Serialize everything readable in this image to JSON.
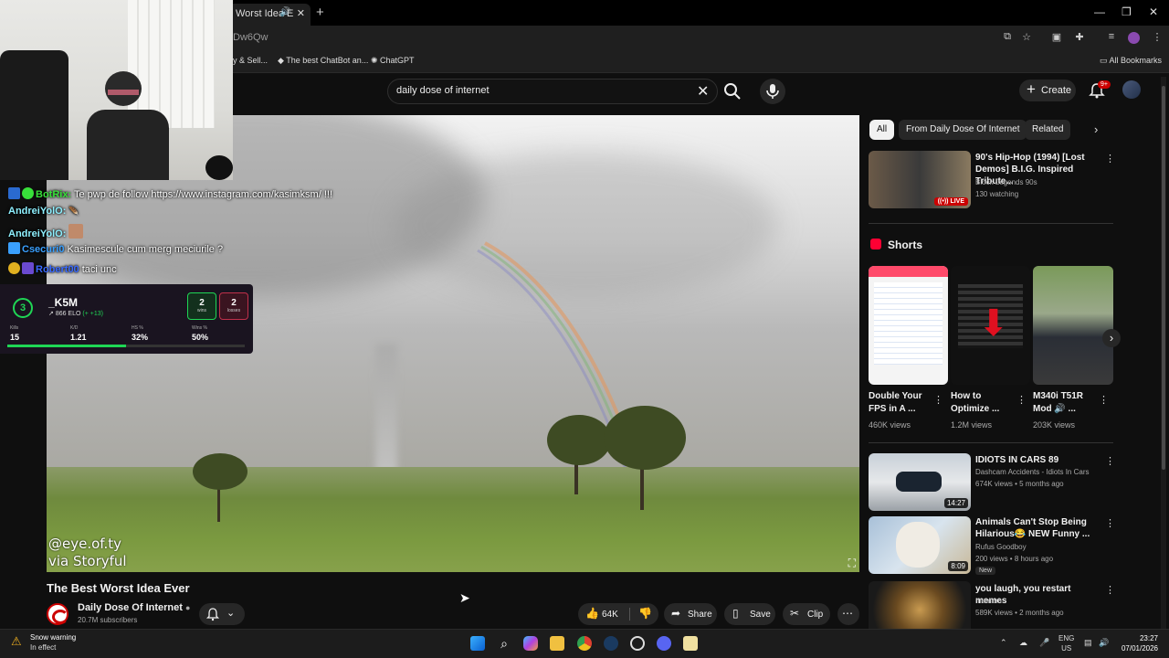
{
  "browser": {
    "tab_title": "Worst Idea E",
    "url": "Dw6Qw",
    "bookmarks": [
      "y & Sell...",
      "The best ChatBot an...",
      "ChatGPT"
    ],
    "all_bookmarks": "All Bookmarks"
  },
  "youtube": {
    "search_query": "daily dose of internet",
    "create_label": "Create",
    "notifications_badge": "9+"
  },
  "video": {
    "watermark_line1": "@eye.of.ty",
    "watermark_line2": "via Storyful",
    "title": "The Best Worst Idea Ever",
    "channel_name": "Daily Dose Of Internet",
    "subscribers": "20.7M subscribers",
    "likes": "64K",
    "share_label": "Share",
    "save_label": "Save",
    "clip_label": "Clip"
  },
  "chat": [
    {
      "name": "BotRix:",
      "name_color": "#38e03a",
      "text": "Te pwp de follow https://www.instagram.com/kasimksm/ !!!"
    },
    {
      "name": "AndreiYolO:",
      "name_color": "#8ef0ff",
      "text": ""
    },
    {
      "name": "AndreiYolO:",
      "name_color": "#8ef0ff",
      "text": ""
    },
    {
      "name": "Csecuri0",
      "name_color": "#3aa0ff",
      "text": "Kasimescule cum merg meciurile ?"
    },
    {
      "name": "Robert00",
      "name_color": "#3a6aff",
      "text": "taci unc"
    }
  ],
  "stats": {
    "rank": "3",
    "name": "_K5M",
    "elo": "866 ELO",
    "elo_gain": "(+ +13)",
    "wins": "2",
    "wins_label": "wins",
    "losses": "2",
    "losses_label": "losses",
    "kills_label": "Kills",
    "kills": "15",
    "kd_label": "K/D",
    "kd": "1.21",
    "hs_label": "HS %",
    "hs": "32%",
    "winrate_label": "Wins %",
    "winrate": "50%",
    "winrate_fraction": 0.5
  },
  "chips": [
    "All",
    "From Daily Dose Of Internet",
    "Related"
  ],
  "related": [
    {
      "title": "90's Hip-Hop (1994) [Lost Demos] B.I.G. Inspired Tribute...",
      "channel": "Block Legends 90s",
      "meta": "130 watching",
      "badge": "LIVE"
    },
    {
      "title": "IDIOTS IN CARS 89",
      "channel": "Dashcam Accidents - Idiots In Cars",
      "meta": "674K views • 5 months ago",
      "duration": "14:27"
    },
    {
      "title": "Animals Can't Stop Being Hilarious😂 NEW Funny ...",
      "channel": "Rufus Goodboy",
      "meta": "200 views • 8 hours ago",
      "badge": "New",
      "duration": "8:09"
    },
    {
      "title": "you laugh, you restart memes",
      "channel": "memem",
      "meta": "589K views • 2 months ago"
    }
  ],
  "shorts": {
    "heading": "Shorts",
    "items": [
      {
        "title": "Double Your FPS in A ...",
        "views": "460K views"
      },
      {
        "title": "How to Optimize ...",
        "views": "1.2M views"
      },
      {
        "title": "M340i T51R Mod 🔊 ...",
        "views": "203K views"
      }
    ]
  },
  "taskbar": {
    "weather_title": "Snow warning",
    "weather_sub": "In effect",
    "lang": "ENG",
    "region": "US",
    "time": "23:27",
    "date": "07/01/2026"
  },
  "colors": {
    "accent": "#cc0000",
    "bg": "#0f0f0f",
    "chip": "#272727",
    "stats_green": "#1fd655"
  }
}
